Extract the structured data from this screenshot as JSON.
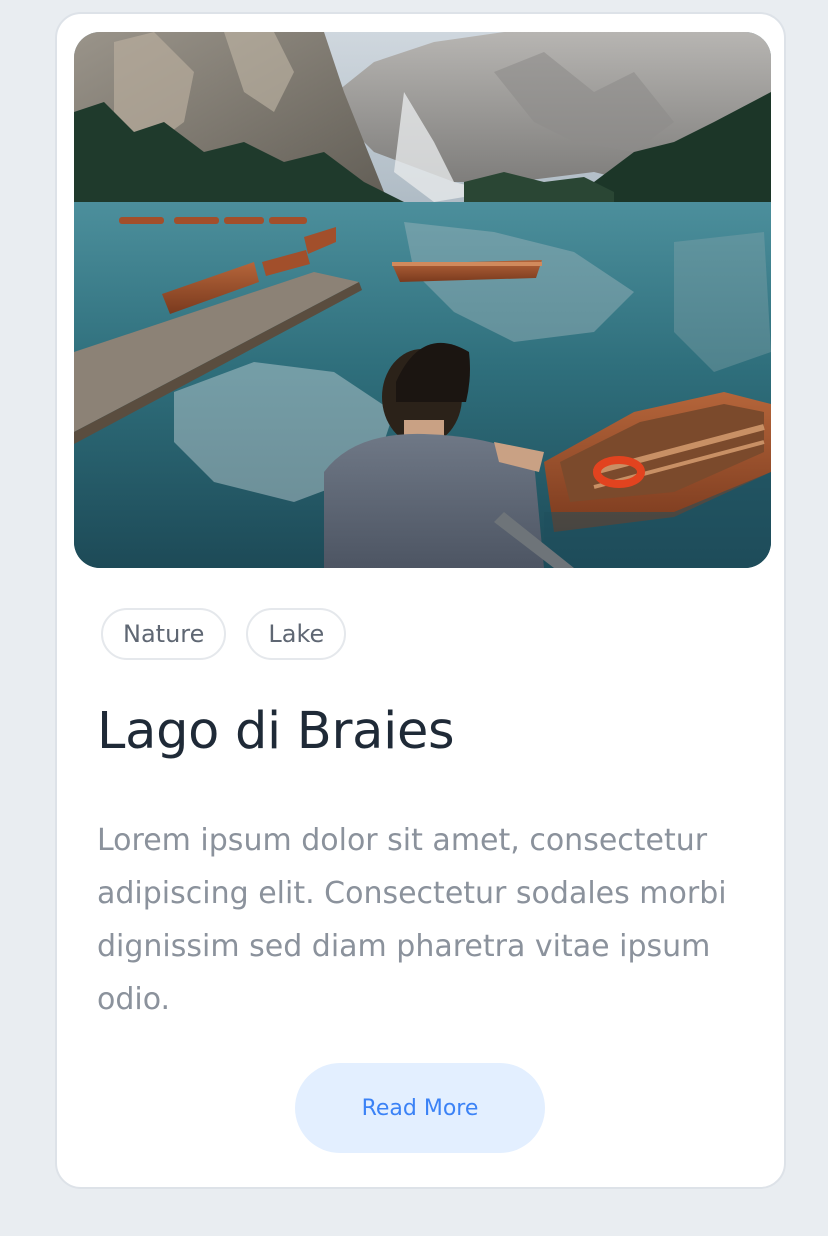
{
  "card": {
    "image_alt": "Man sitting on a dock by a turquoise mountain lake with wooden rowboats",
    "tags": [
      {
        "label": "Nature"
      },
      {
        "label": "Lake"
      }
    ],
    "title": "Lago di Braies",
    "description": "Lorem ipsum dolor sit amet, consectetur adipiscing elit. Consectetur sodales morbi dignissim sed diam pharetra vitae ipsum odio.",
    "button_label": "Read More"
  },
  "colors": {
    "page_background": "#e9edf1",
    "card_background": "#ffffff",
    "title": "#1f2a37",
    "body_text": "#8b929c",
    "button_background": "#e3efff",
    "button_text": "#3b82f6"
  }
}
